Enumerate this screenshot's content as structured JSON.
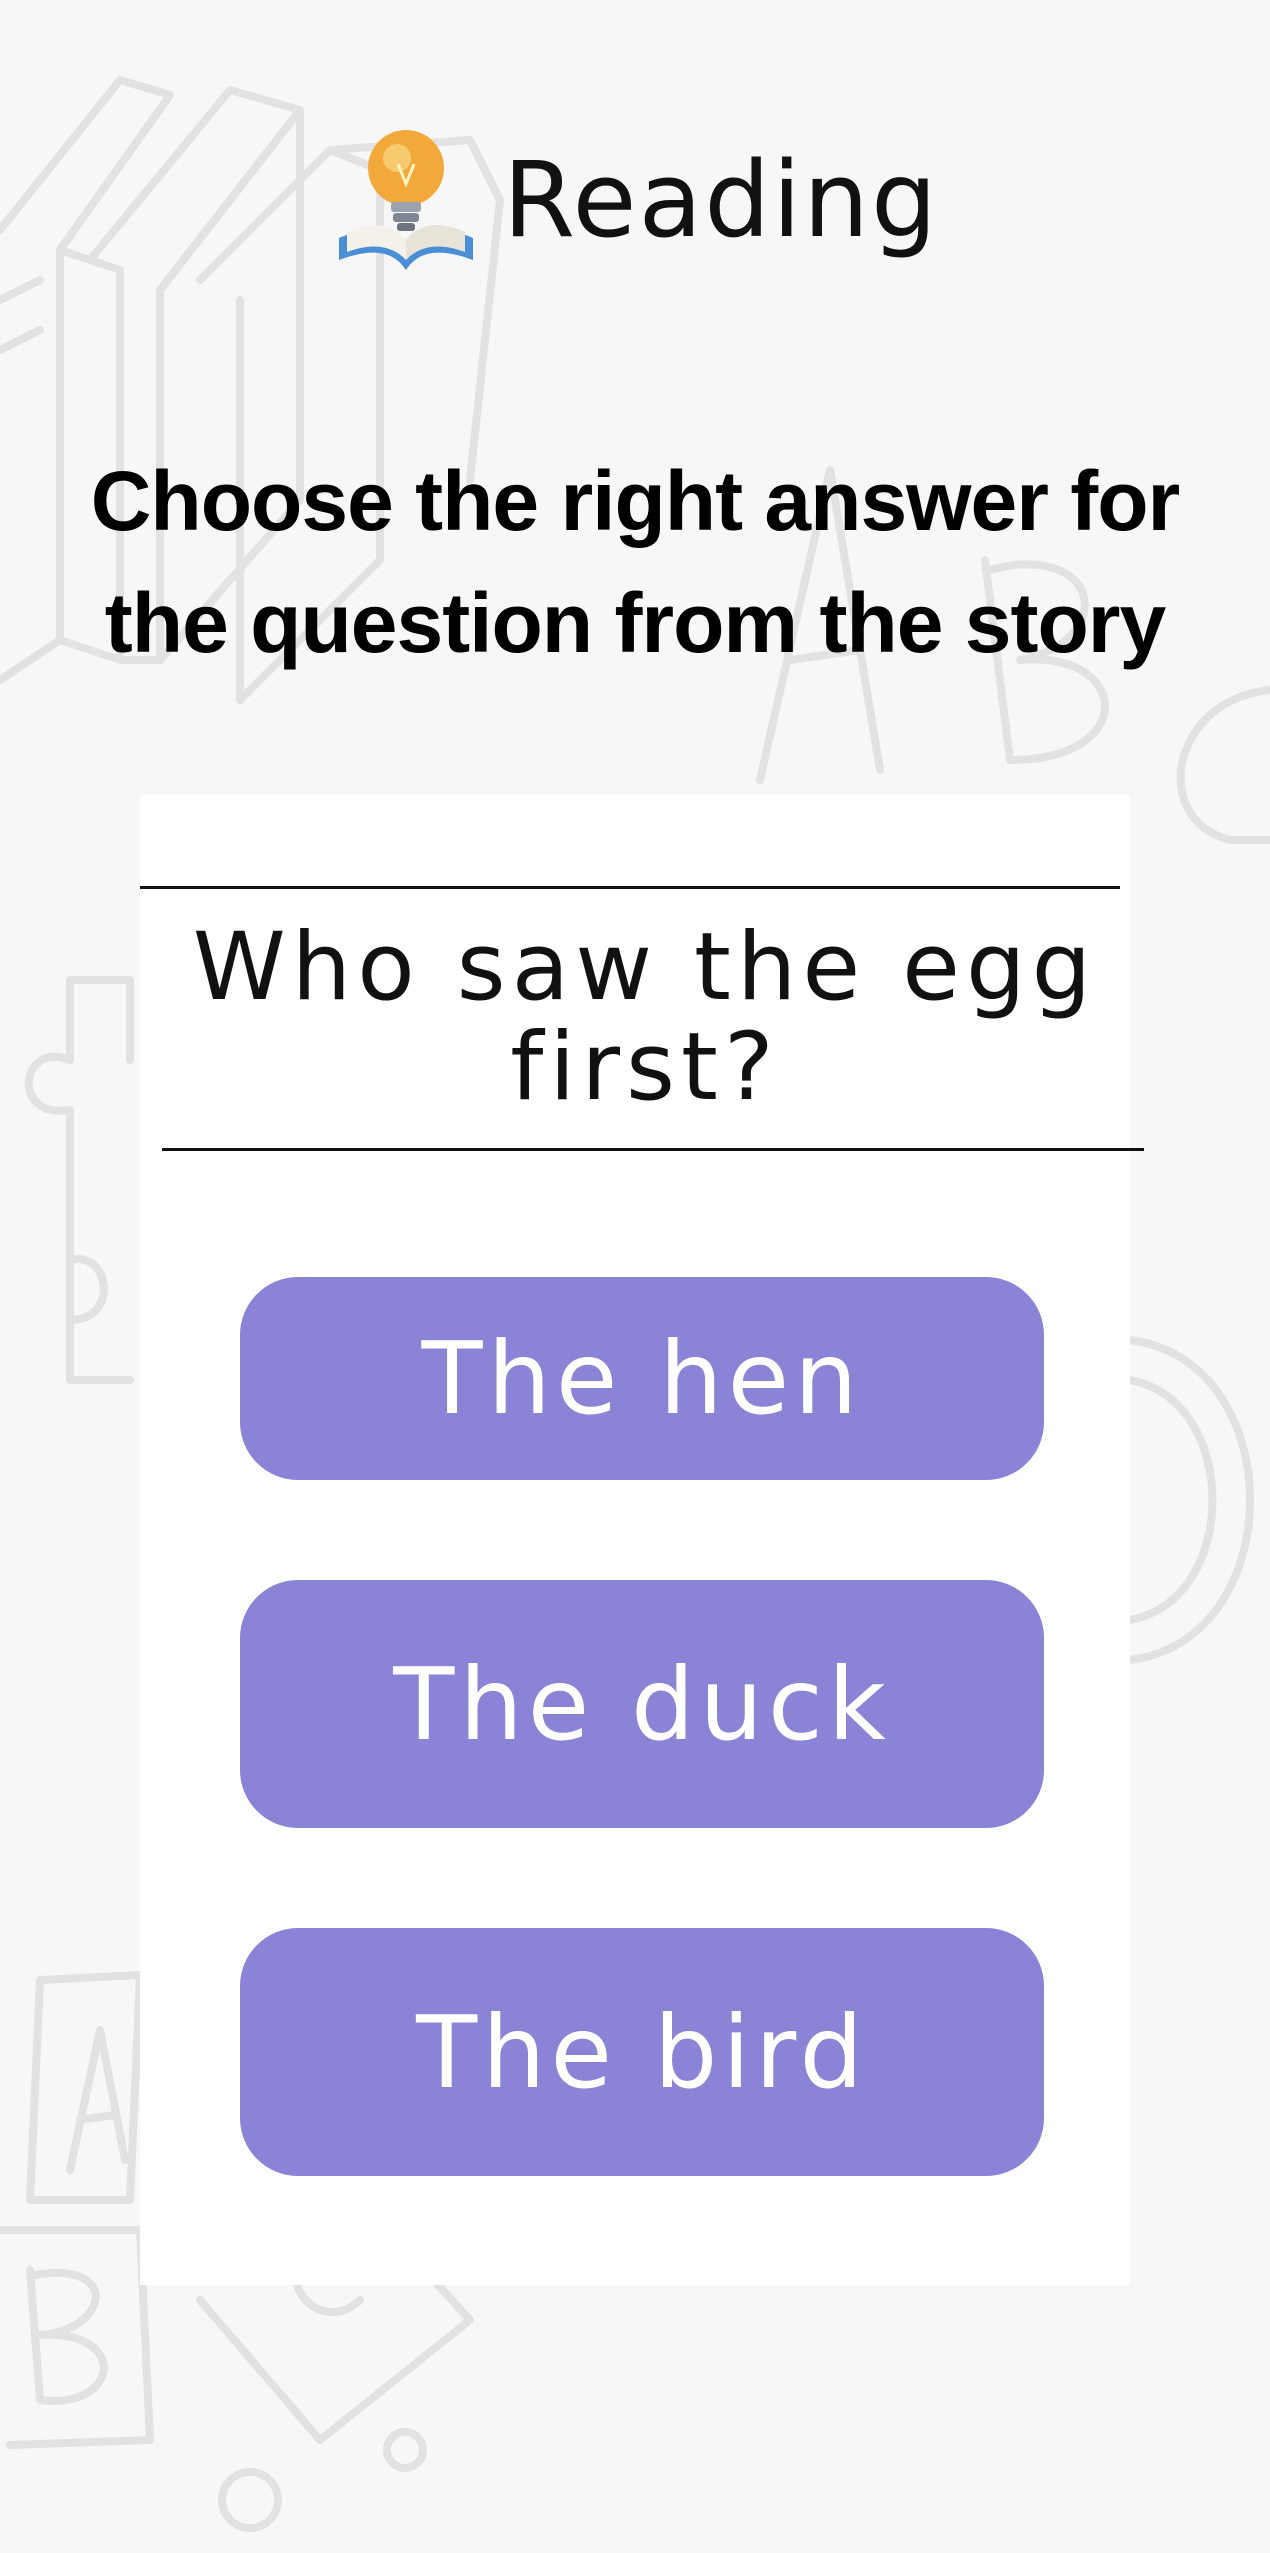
{
  "header": {
    "title": "Reading",
    "icon": "lightbulb-book-icon"
  },
  "instruction": {
    "text": "Choose the right answer for the question from the story"
  },
  "question": {
    "text": "Who saw the egg first?"
  },
  "answers": [
    {
      "label": "The hen"
    },
    {
      "label": "The duck"
    },
    {
      "label": "The bird"
    }
  ],
  "colors": {
    "background": "#f7f7f7",
    "card": "#ffffff",
    "answer_button": "#8b83d6",
    "answer_text": "#ffffff",
    "doodle": "#e3e3e3"
  }
}
